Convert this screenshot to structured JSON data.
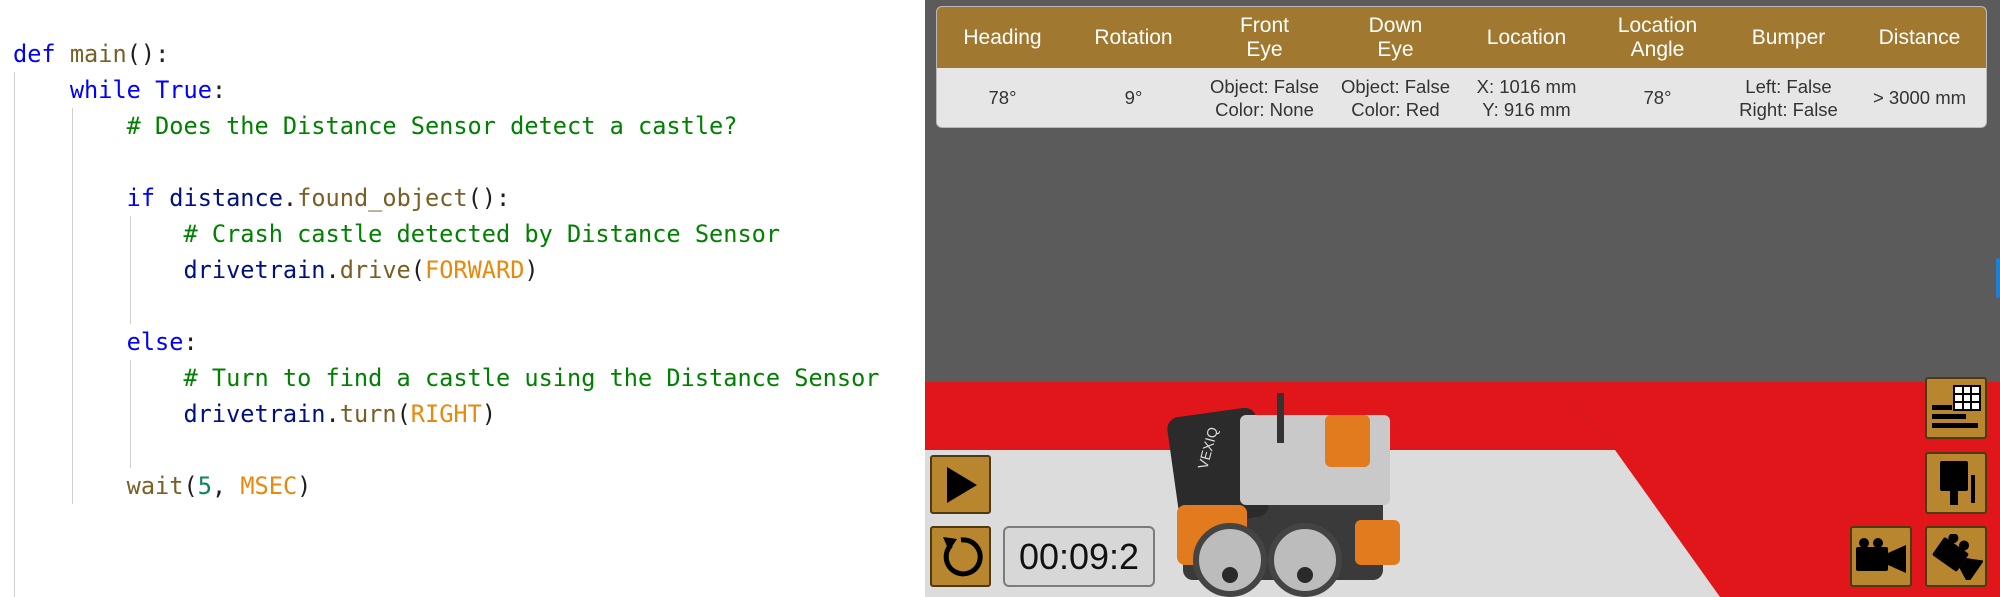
{
  "editor": {
    "def_kw": "def",
    "func_name": "main",
    "func_tail": "():",
    "while_kw": "while",
    "true_kw": "True",
    "while_tail": ":",
    "comment_detect": "# Does the Distance Sensor detect a castle?",
    "if_kw": "if",
    "distance_obj": "distance",
    "found_object_method": "found_object",
    "if_tail": "():",
    "comment_crash": "# Crash castle detected by Distance Sensor",
    "drivetrain_obj_1": "drivetrain",
    "drive_method": "drive",
    "forward_const": "FORWARD",
    "else_kw": "else",
    "else_tail": ":",
    "comment_turn": "# Turn to find a castle using the Distance Sensor",
    "drivetrain_obj_2": "drivetrain",
    "turn_method": "turn",
    "right_const": "RIGHT",
    "wait_func": "wait",
    "wait_value": "5",
    "msec_const": "MSEC"
  },
  "simulator": {
    "sensor_headers": [
      "Heading",
      "Rotation",
      "Front\nEye",
      "Down\nEye",
      "Location",
      "Location\nAngle",
      "Bumper",
      "Distance"
    ],
    "sensor_values": [
      "78°",
      "9°",
      "Object: False\nColor: None",
      "Object: False\nColor: Red",
      "X: 1016 mm\nY: 916 mm",
      "78°",
      "Left: False\nRight: False",
      "> 3000 mm"
    ],
    "timer": "00:09:2",
    "robot_logo": "VEXIQ",
    "icons": [
      "play-icon",
      "reset-icon",
      "sensor-dashboard-icon",
      "robot-view-icon",
      "camera-follow-icon",
      "camera-angle-icon"
    ],
    "colors": {
      "header_gold": "#a17830",
      "button_gold": "#b8862e",
      "field_red": "#e0161b",
      "background_gray": "#5a5b5a"
    }
  }
}
